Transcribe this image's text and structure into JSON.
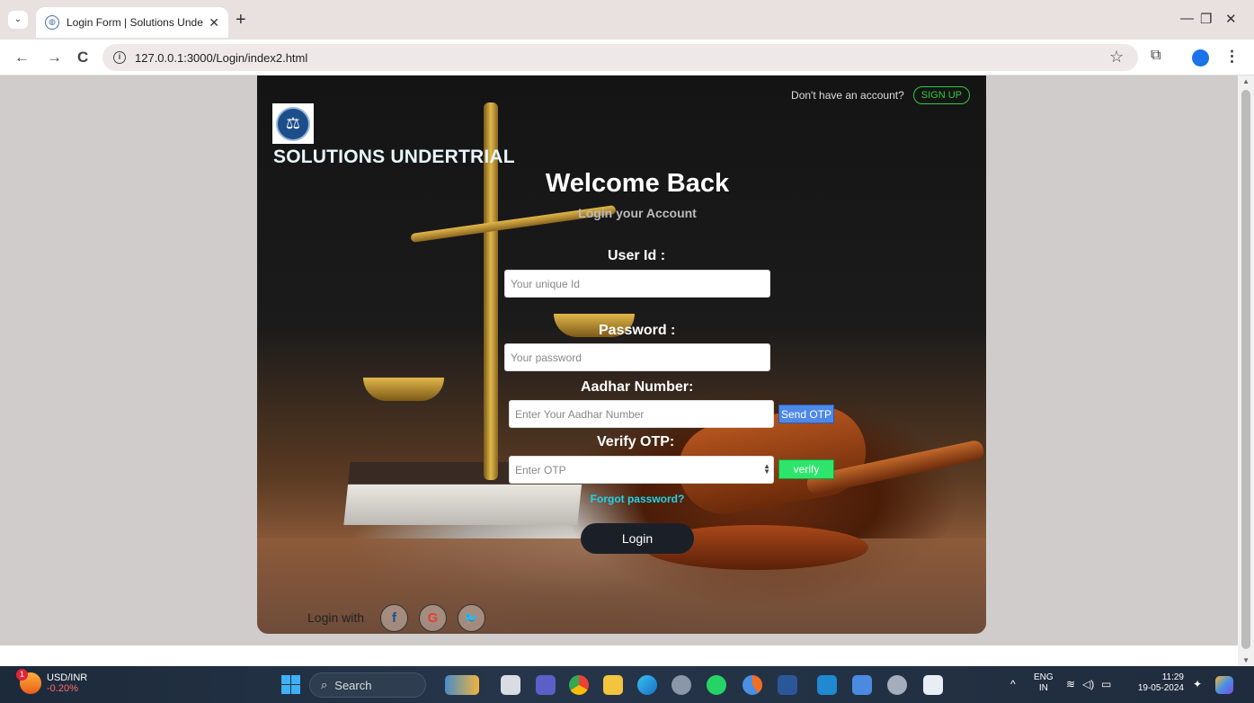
{
  "browser": {
    "tab_title": "Login Form | Solutions Undertri",
    "url": "127.0.0.1:3000/Login/index2.html",
    "tab_close": "✕",
    "new_tab": "+",
    "back": "←",
    "forward": "→",
    "reload": "C",
    "minimize": "—",
    "restore": "❐",
    "close": "✕"
  },
  "header": {
    "signup_prompt": "Don't have an account?",
    "signup_label": "SIGN UP",
    "brand": "SOLUTIONS UNDERTRIAL"
  },
  "form": {
    "title": "Welcome Back",
    "subtitle": "Login your Account",
    "user_id_label": "User Id :",
    "user_id_placeholder": "Your unique Id",
    "password_label": "Password :",
    "password_placeholder": "Your password",
    "aadhar_label": "Aadhar Number:",
    "aadhar_placeholder": "Enter Your Aadhar Number",
    "send_otp_label": "Send OTP",
    "otp_label": "Verify OTP:",
    "otp_placeholder": "Enter OTP",
    "verify_label": "verify",
    "forgot_label": "Forgot password?",
    "login_label": "Login"
  },
  "social": {
    "label": "Login with",
    "facebook": "f",
    "google": "G",
    "twitter": "🐦"
  },
  "taskbar": {
    "ticker_name": "USD/INR",
    "ticker_change": "-0.20%",
    "ticker_badge": "1",
    "search_label": "Search",
    "lang_top": "ENG",
    "lang_bottom": "IN",
    "time": "11:29",
    "date": "19-05-2024"
  },
  "colors": {
    "signup": "#2ecc40",
    "send_otp": "#4d89e8",
    "verify": "#2ee56b",
    "forgot": "#21d3e8",
    "login_button": "#1b2028"
  }
}
